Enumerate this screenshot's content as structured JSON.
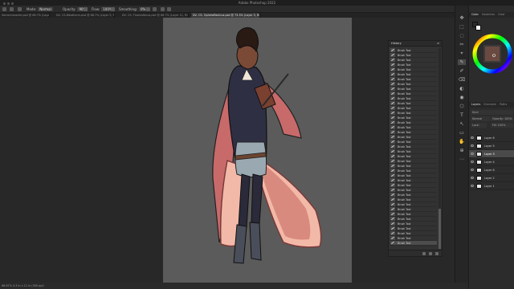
{
  "app_title": "Adobe Photoshop 2022",
  "options": {
    "mode_label": "Mode:",
    "mode_value": "Normal",
    "opacity_label": "Opacity:",
    "opacity_value": "90%",
    "flow_label": "Flow:",
    "flow_value": "100%",
    "smoothing_label": "Smoothing:",
    "smoothing_value": "0%"
  },
  "tabs": [
    "Somecharacter.psd @ 66.7% (Layer 9, RGB/8)",
    "DV- CS-Weatherrs.psd @ 66.7% (Layer 5, RGB/8)",
    "DV- CS- ThanksNicca.psd @ 66.7% (Layer 11, RGB/8)",
    "DV- CS- OphelaMarinus.psd @ 73.3% (Layer 5, RGB/8)"
  ],
  "status_text": "66.67% 4.3 in x 11 in (300 ppi)",
  "history": {
    "title": "History",
    "menu": "≡",
    "items": [
      "Brush Tool",
      "Brush Tool",
      "Brush Tool",
      "Brush Tool",
      "Brush Tool",
      "Brush Tool",
      "Brush Tool",
      "Brush Tool",
      "Brush Tool",
      "Brush Tool",
      "Brush Tool",
      "Brush Tool",
      "Brush Tool",
      "Brush Tool",
      "Brush Tool",
      "Brush Tool",
      "Brush Tool",
      "Brush Tool",
      "Brush Tool",
      "Brush Tool",
      "Brush Tool",
      "Brush Tool",
      "Brush Tool",
      "Brush Tool",
      "Brush Tool",
      "Brush Tool",
      "Brush Tool",
      "Brush Tool",
      "Brush Tool",
      "Brush Tool",
      "Brush Tool",
      "Brush Tool",
      "Brush Tool",
      "Brush Tool",
      "Brush Tool",
      "Brush Tool",
      "Brush Tool",
      "Brush Tool",
      "Brush Tool",
      "Brush Tool",
      "Brush Tool"
    ],
    "active_index": 40
  },
  "dock": {
    "color_tabs": [
      "Color",
      "Swatches",
      "Grad"
    ],
    "layer_tabs": [
      "Layers",
      "Channels",
      "Paths"
    ],
    "kind_label": "Kind",
    "blend_value": "Normal",
    "opacity_label": "Opacity: 100%",
    "fill_label": "Fill: 100%",
    "lock_label": "Lock:"
  },
  "layers": [
    {
      "name": "Layer 6"
    },
    {
      "name": "Layer 5"
    },
    {
      "name": "Layer 3"
    },
    {
      "name": "Layer 4"
    },
    {
      "name": "Layer 8"
    },
    {
      "name": "Layer 2"
    },
    {
      "name": "Layer 1"
    }
  ],
  "active_layer": 2,
  "colors": {
    "foreground": "#2a2a2a",
    "background": "#ffffff",
    "canvas": "#5b5b5b",
    "coat": "#2f2f44",
    "cape_lining": "#c86a6a",
    "skirt": "#f3b9a8",
    "skin": "#7b4a36"
  }
}
